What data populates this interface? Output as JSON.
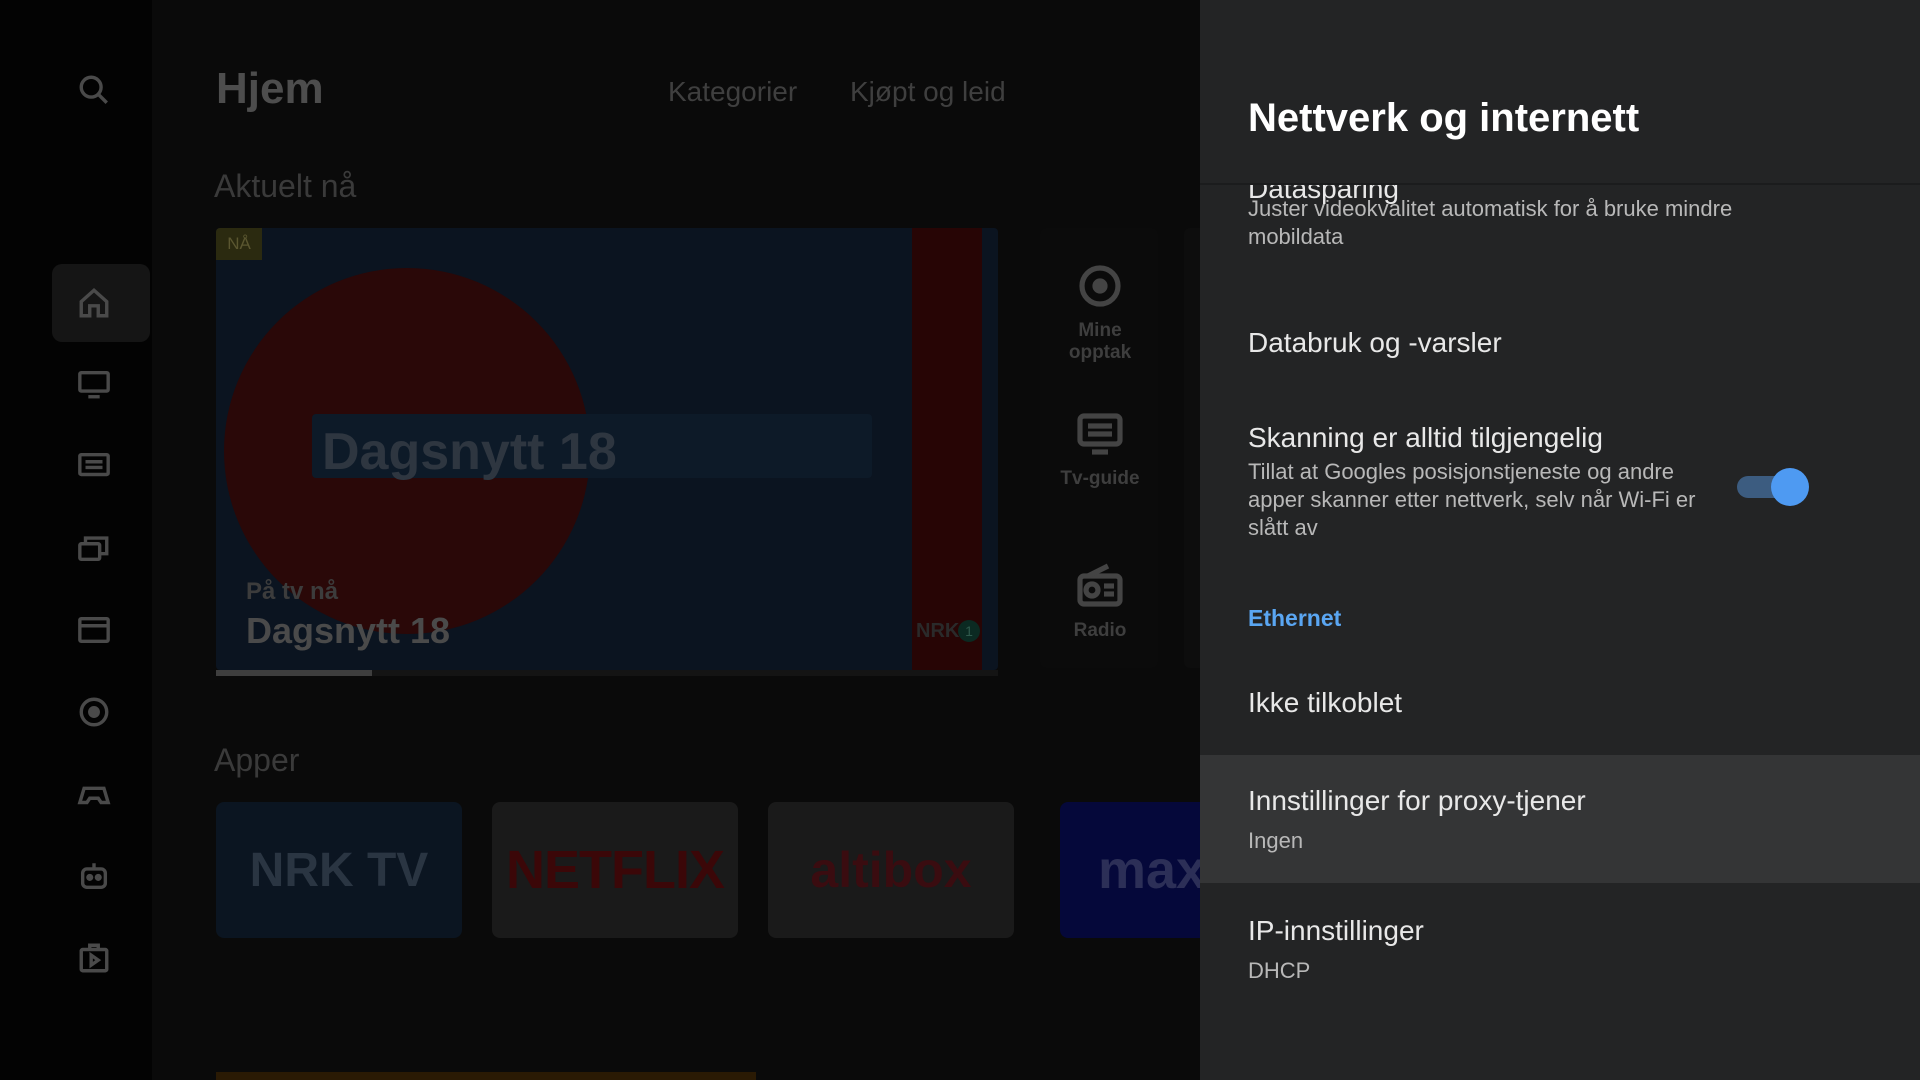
{
  "home": {
    "title": "Hjem",
    "nav_links": [
      "Kategorier",
      "Kjøpt og leid"
    ],
    "section_now": "Aktuelt nå",
    "section_apps": "Apper",
    "hero": {
      "badge": "NÅ",
      "show_graphic_text": "Dagsnytt 18",
      "subtitle": "På tv nå",
      "title": "Dagsnytt 18",
      "channel_logo_text": "NRK",
      "channel_number": "1",
      "progress_fraction": 0.2
    },
    "quick_tiles": [
      {
        "label_line1": "Mine",
        "label_line2": "opptak",
        "icon": "record-icon"
      },
      {
        "label_line1": "Tv-guide",
        "label_line2": "",
        "icon": "tv-guide-icon"
      },
      {
        "label_line1": "Radio",
        "label_line2": "",
        "icon": "radio-icon"
      }
    ],
    "apps": [
      {
        "name": "NRK TV",
        "logo_text": "NRK TV"
      },
      {
        "name": "Netflix",
        "logo_text": "NETFLIX"
      },
      {
        "name": "Altibox",
        "logo_text": "altibox"
      },
      {
        "name": "Max",
        "logo_text": "max"
      }
    ],
    "rail_icons": [
      "search-icon",
      "home-icon",
      "tv-icon",
      "guide-icon",
      "recordings-icon",
      "movies-icon",
      "record-icon",
      "games-icon",
      "kids-icon",
      "play-store-icon"
    ]
  },
  "panel": {
    "title": "Nettverk og internett",
    "items": {
      "datasparing": {
        "title": "Datasparing",
        "subtitle": "Juster videokvalitet automatisk for å bruke mindre mobildata"
      },
      "databruk": {
        "title": "Databruk og -varsler"
      },
      "skanning": {
        "title": "Skanning er alltid tilgjengelig",
        "subtitle": "Tillat at Googles posisjonstjeneste og andre apper skanner etter nettverk, selv når Wi-Fi er slått av",
        "toggle_on": true
      },
      "ethernet_header": "Ethernet",
      "ikke_tilkoblet": {
        "title": "Ikke tilkoblet"
      },
      "proxy": {
        "title": "Innstillinger for proxy-tjener",
        "subtitle": "Ingen"
      },
      "ip": {
        "title": "IP-innstillinger",
        "subtitle": "DHCP"
      }
    }
  },
  "colors": {
    "panel_bg": "#232425",
    "focused_row": "#343536",
    "accent": "#5aa6f2",
    "toggle_knob": "#4e9af2"
  }
}
